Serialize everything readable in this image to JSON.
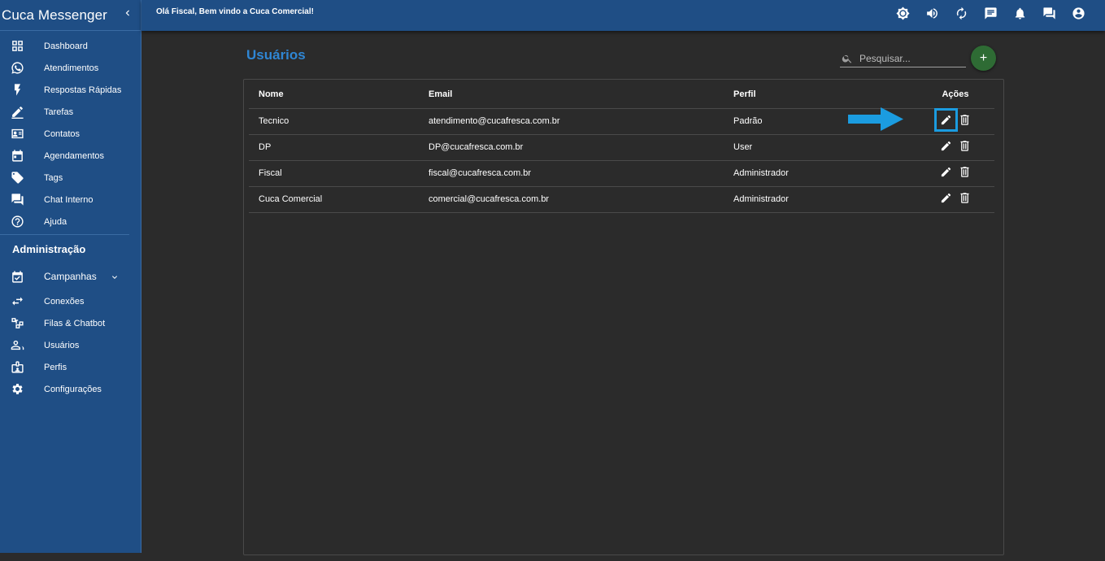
{
  "sidebar": {
    "brand": "Cuca Messenger",
    "items": [
      {
        "label": "Dashboard",
        "icon": "dashboard-icon"
      },
      {
        "label": "Atendimentos",
        "icon": "whatsapp-icon"
      },
      {
        "label": "Respostas Rápidas",
        "icon": "bolt-icon"
      },
      {
        "label": "Tarefas",
        "icon": "pencil-icon"
      },
      {
        "label": "Contatos",
        "icon": "contacts-icon"
      },
      {
        "label": "Agendamentos",
        "icon": "calendar-icon"
      },
      {
        "label": "Tags",
        "icon": "tag-icon"
      },
      {
        "label": "Chat Interno",
        "icon": "chat-icon"
      },
      {
        "label": "Ajuda",
        "icon": "help-icon"
      }
    ],
    "admin_title": "Administração",
    "admin_items": [
      {
        "label": "Campanhas",
        "icon": "event-icon"
      },
      {
        "label": "Conexões",
        "icon": "swap-icon"
      },
      {
        "label": "Filas & Chatbot",
        "icon": "flow-icon"
      },
      {
        "label": "Usuários",
        "icon": "users-icon"
      },
      {
        "label": "Perfis",
        "icon": "badge-icon"
      },
      {
        "label": "Configurações",
        "icon": "gear-icon"
      }
    ]
  },
  "topbar": {
    "welcome": "Olá Fiscal, Bem vindo a Cuca Comercial!",
    "icons": [
      "brightness-icon",
      "volume-icon",
      "refresh-icon",
      "message-icon",
      "bell-icon",
      "forum-icon",
      "account-icon"
    ]
  },
  "main": {
    "title": "Usuários",
    "search_placeholder": "Pesquisar...",
    "add_label": "+",
    "columns": [
      "Nome",
      "Email",
      "Perfil",
      "Ações"
    ],
    "rows": [
      {
        "nome": "Tecnico",
        "email": "atendimento@cucafresca.com.br",
        "perfil": "Padrão"
      },
      {
        "nome": "DP",
        "email": "DP@cucafresca.com.br",
        "perfil": "User"
      },
      {
        "nome": "Fiscal",
        "email": "fiscal@cucafresca.com.br",
        "perfil": "Administrador"
      },
      {
        "nome": "Cuca Comercial",
        "email": "comercial@cucafresca.com.br",
        "perfil": "Administrador"
      }
    ]
  },
  "colors": {
    "sidebar": "#1f4e85",
    "title": "#2f86d4",
    "add_button": "#2e6b34",
    "highlight": "#1b9ce0"
  }
}
